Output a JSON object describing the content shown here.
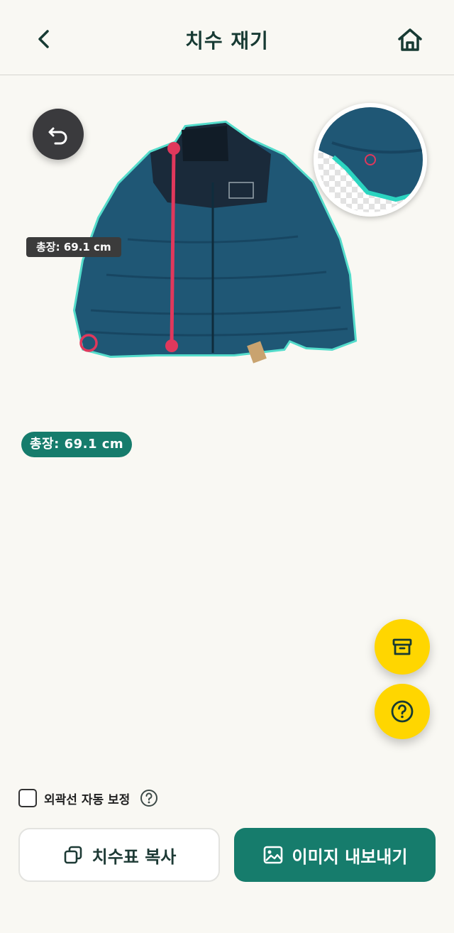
{
  "header": {
    "title": "치수 재기",
    "back_icon": "chevron-left-icon",
    "home_icon": "home-icon"
  },
  "canvas": {
    "image": "puffer-jacket-photo",
    "measurement_tag": "총장: 69.1 cm",
    "measure_line_color": "#e0385c",
    "outline_color": "#2bd4c0"
  },
  "result": {
    "chip_label": "총장: 69.1 cm"
  },
  "fabs": {
    "archive_icon": "archive-icon",
    "help_icon": "help-icon",
    "color": "#ffd600"
  },
  "options": {
    "auto_correct_label": "외곽선 자동 보정",
    "auto_correct_checked": false
  },
  "actions": {
    "copy_label": "치수표 복사",
    "export_label": "이미지 내보내기"
  },
  "colors": {
    "primary": "#167c6c",
    "background": "#f9f8f3"
  }
}
